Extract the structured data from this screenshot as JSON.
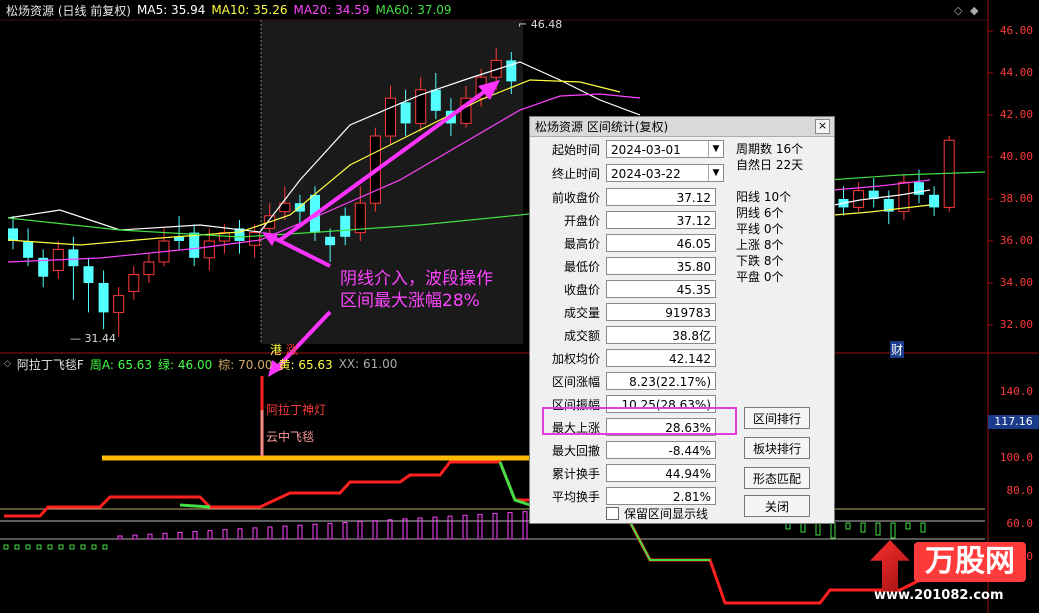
{
  "header": {
    "title": "松炀资源 (日线 前复权)",
    "ma5": "MA5: 35.94",
    "ma10": "MA10: 35.26",
    "ma20": "MA20: 34.59",
    "ma60": "MA60: 37.09"
  },
  "price_axis": [
    "46.00",
    "44.00",
    "42.00",
    "40.00",
    "38.00",
    "36.00",
    "34.00",
    "32.00"
  ],
  "price_marks": {
    "high": "46.48",
    "low": "31.44"
  },
  "chart_tags": {
    "gang": "港",
    "zhang": "涨",
    "cai": "财"
  },
  "indicator": {
    "name": "阿拉丁飞毯F",
    "zhou": "周A: 65.63",
    "lv": "绿: 46.00",
    "zong": "棕: 70.00",
    "huang": "黄: 65.63",
    "xx": "XX: 61.00",
    "aladdin": "阿拉丁神灯",
    "yunzhong": "云中飞毯"
  },
  "ind_axis": [
    "140.0",
    "100.0",
    "80.0",
    "60.0",
    "40.0"
  ],
  "ind_current": "117.16",
  "annotation": {
    "line1": "阴线介入，波段操作",
    "line2": "区间最大涨幅28%"
  },
  "dialog": {
    "title": "松炀资源 区间统计(复权)",
    "start_label": "起始时间",
    "start_value": "2024-03-01",
    "end_label": "终止时间",
    "end_value": "2024-03-22",
    "fields": [
      {
        "label": "前收盘价",
        "value": "37.12"
      },
      {
        "label": "开盘价",
        "value": "37.12"
      },
      {
        "label": "最高价",
        "value": "46.05"
      },
      {
        "label": "最低价",
        "value": "35.80"
      },
      {
        "label": "收盘价",
        "value": "45.35"
      },
      {
        "label": "成交量",
        "value": "919783"
      },
      {
        "label": "成交额",
        "value": "38.8亿"
      },
      {
        "label": "加权均价",
        "value": "42.142"
      },
      {
        "label": "区间涨幅",
        "value": "8.23(22.17%)"
      },
      {
        "label": "区间振幅",
        "value": "10.25(28.63%)"
      },
      {
        "label": "最大上涨",
        "value": "28.63%"
      },
      {
        "label": "最大回撤",
        "value": "-8.44%"
      },
      {
        "label": "累计换手",
        "value": "44.94%"
      },
      {
        "label": "平均换手",
        "value": "2.81%"
      }
    ],
    "stats": [
      "周期数 16个",
      "自然日 22天",
      "",
      "阳线 10个",
      "阴线 6个",
      "平线 0个",
      "上涨 8个",
      "下跌 8个",
      "平盘 0个"
    ],
    "buttons": [
      "区间排行",
      "板块排行",
      "形态匹配",
      "关闭"
    ],
    "checkbox_label": "保留区间显示线"
  },
  "watermark": {
    "brand": "万股网",
    "url": "www.201082.com"
  },
  "colors": {
    "up": "#ff3a3a",
    "down": "#54ffff",
    "ma5": "#ffffff",
    "ma10": "#ffff44",
    "ma20": "#ff44ff",
    "ma60": "#44dd44",
    "annotation": "#ff44ff"
  }
}
